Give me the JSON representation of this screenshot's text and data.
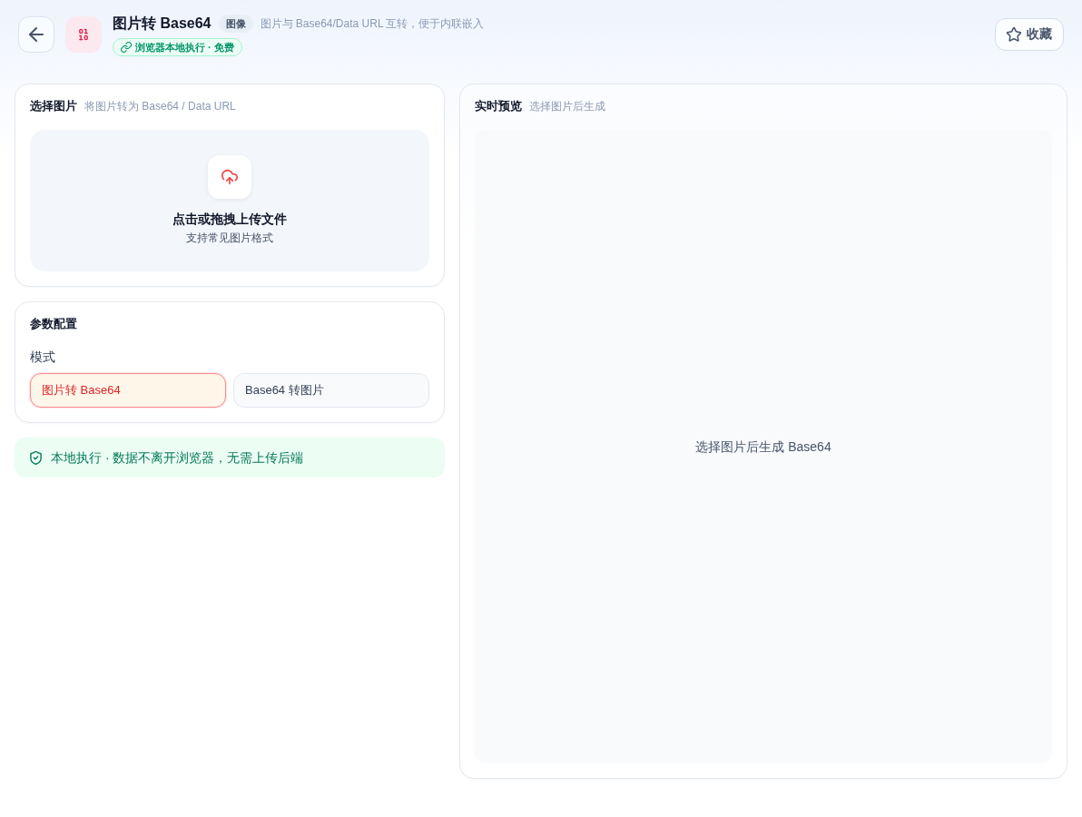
{
  "header": {
    "title": "图片转 Base64",
    "category_badge": "图像",
    "description": "图片与 Base64/Data URL 互转，便于内联嵌入",
    "status_badge": "浏览器本地执行 · 免费",
    "favorite_button": {
      "label": "收藏",
      "starred": false
    }
  },
  "input_card": {
    "title": "选择图片",
    "subtitle": "将图片转为 Base64 / Data URL",
    "dropzone": {
      "title": "点击或拖拽上传文件",
      "hint": "支持常见图片格式"
    }
  },
  "settings_card": {
    "title": "参数配置",
    "mode": {
      "label": "模式",
      "options": [
        {
          "label": "图片转 Base64",
          "selected": true
        },
        {
          "label": "Base64 转图片",
          "selected": false
        }
      ]
    }
  },
  "notice": "本地执行 · 数据不离开浏览器，无需上传后端",
  "preview_card": {
    "title": "实时预览",
    "subtitle": "选择图片后生成",
    "empty_text": "选择图片后生成 Base64"
  }
}
